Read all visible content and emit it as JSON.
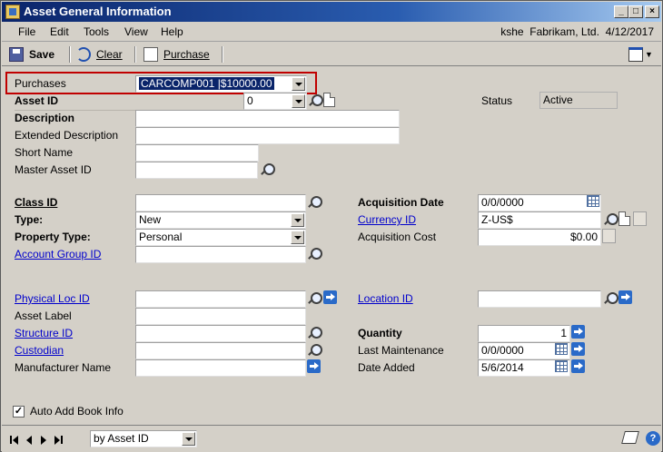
{
  "window": {
    "title": "Asset General Information"
  },
  "menu": {
    "items": [
      "File",
      "Edit",
      "Tools",
      "View",
      "Help"
    ],
    "user": "kshe",
    "company": "Fabrikam, Ltd.",
    "date": "4/12/2017"
  },
  "toolbar": {
    "save": "Save",
    "clear": "Clear",
    "purchase": "Purchase"
  },
  "form": {
    "purchases": {
      "label": "Purchases",
      "value": "CARCOMP001   |$10000.00"
    },
    "asset_id": {
      "label": "Asset ID",
      "value": "0"
    },
    "status": {
      "label": "Status",
      "value": "Active"
    },
    "description": {
      "label": "Description",
      "value": ""
    },
    "extended_description": {
      "label": "Extended Description",
      "value": ""
    },
    "short_name": {
      "label": "Short Name",
      "value": ""
    },
    "master_asset_id": {
      "label": "Master Asset ID",
      "value": ""
    },
    "class_id": {
      "label": "Class ID",
      "value": ""
    },
    "type": {
      "label": "Type:",
      "value": "New"
    },
    "property_type": {
      "label": "Property Type:",
      "value": "Personal"
    },
    "account_group_id": {
      "label": "Account Group ID",
      "value": ""
    },
    "acquisition_date": {
      "label": "Acquisition Date",
      "value": "0/0/0000"
    },
    "currency_id": {
      "label": "Currency ID",
      "value": "Z-US$"
    },
    "acquisition_cost": {
      "label": "Acquisition Cost",
      "value": "$0.00"
    },
    "physical_loc_id": {
      "label": "Physical Loc ID",
      "value": ""
    },
    "asset_label": {
      "label": "Asset Label",
      "value": ""
    },
    "structure_id": {
      "label": "Structure ID",
      "value": ""
    },
    "custodian": {
      "label": "Custodian",
      "value": ""
    },
    "manufacturer_name": {
      "label": "Manufacturer Name",
      "value": ""
    },
    "location_id": {
      "label": "Location ID",
      "value": ""
    },
    "quantity": {
      "label": "Quantity",
      "value": "1"
    },
    "last_maintenance": {
      "label": "Last Maintenance",
      "value": "0/0/0000"
    },
    "date_added": {
      "label": "Date Added",
      "value": "5/6/2014"
    },
    "auto_add_book_info": {
      "label": "Auto Add Book Info",
      "checked": true
    }
  },
  "statusbar": {
    "sort": "by Asset ID"
  },
  "colors": {
    "title_start": "#0a246a",
    "link": "#0000cc",
    "highlight": "#c00000"
  }
}
